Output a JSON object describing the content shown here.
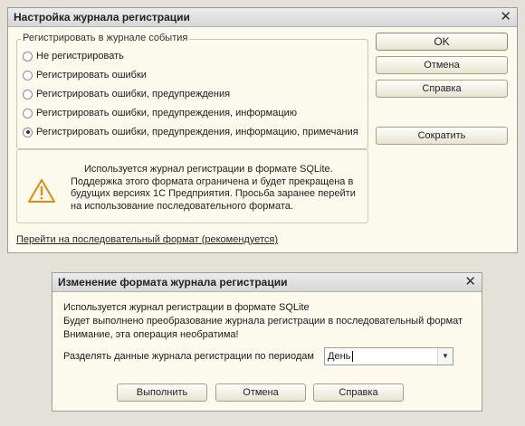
{
  "settings": {
    "title": "Настройка журнала регистрации",
    "group_title": "Регистрировать в журнале события",
    "options": [
      "Не регистрировать",
      "Регистрировать ошибки",
      "Регистрировать ошибки, предупреждения",
      "Регистрировать ошибки, предупреждения, информацию",
      "Регистрировать ошибки, предупреждения, информацию, примечания"
    ],
    "selected_option": "Регистрировать ошибки, предупреждения, информацию, примечания",
    "warning_lines": [
      "Используется журнал регистрации в формате SQLite.",
      "Поддержка этого формата ограничена и будет прекращена в",
      "будущих версиях  1С Предприятия. Просьба заранее перейти",
      "на использование последовательного формата."
    ],
    "switch_link": "Перейти на последовательный формат (рекомендуется)",
    "buttons": {
      "ok": "OK",
      "cancel": "Отмена",
      "help": "Справка",
      "shrink": "Сократить"
    }
  },
  "convert": {
    "title": "Изменение формата журнала регистрации",
    "lines": [
      "Используется журнал регистрации в формате SQLite",
      "Будет выполнено преобразование журнала регистрации в последовательный формат",
      "Внимание, эта операция необратима!"
    ],
    "period_label": "Разделять данные журнала регистрации по периодам",
    "period_value": "День",
    "buttons": {
      "run": "Выполнить",
      "cancel": "Отмена",
      "help": "Справка"
    }
  }
}
